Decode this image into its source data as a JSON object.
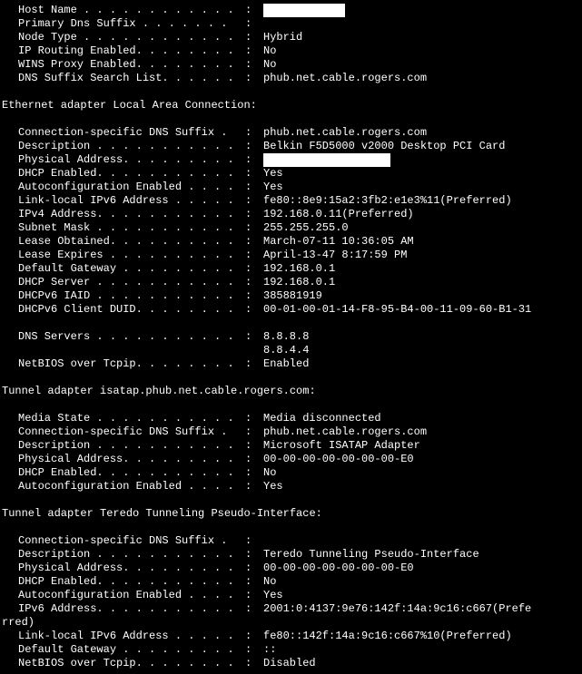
{
  "sep": ": ",
  "main": [
    {
      "label": "Host Name . . . . . . . . . . . .",
      "value": "",
      "block": 90
    },
    {
      "label": "Primary Dns Suffix  . . . . . . .",
      "value": ""
    },
    {
      "label": "Node Type . . . . . . . . . . . .",
      "value": "Hybrid"
    },
    {
      "label": "IP Routing Enabled. . . . . . . .",
      "value": "No"
    },
    {
      "label": "WINS Proxy Enabled. . . . . . . .",
      "value": "No"
    },
    {
      "label": "DNS Suffix Search List. . . . . .",
      "value": "phub.net.cable.rogers.com"
    }
  ],
  "ethHeader": "Ethernet adapter Local Area Connection:",
  "eth": [
    {
      "label": "Connection-specific DNS Suffix  .",
      "value": "phub.net.cable.rogers.com"
    },
    {
      "label": "Description . . . . . . . . . . .",
      "value": "Belkin F5D5000 v2000 Desktop PCI Card"
    },
    {
      "label": "Physical Address. . . . . . . . .",
      "value": "",
      "block": 140
    },
    {
      "label": "DHCP Enabled. . . . . . . . . . .",
      "value": "Yes"
    },
    {
      "label": "Autoconfiguration Enabled . . . .",
      "value": "Yes"
    },
    {
      "label": "Link-local IPv6 Address . . . . .",
      "value": "fe80::8e9:15a2:3fb2:e1e3%11(Preferred)"
    },
    {
      "label": "IPv4 Address. . . . . . . . . . .",
      "value": "192.168.0.11(Preferred)"
    },
    {
      "label": "Subnet Mask . . . . . . . . . . .",
      "value": "255.255.255.0"
    },
    {
      "label": "Lease Obtained. . . . . . . . . .",
      "value": "March-07-11 10:36:05 AM"
    },
    {
      "label": "Lease Expires . . . . . . . . . .",
      "value": "April-13-47 8:17:59 PM"
    },
    {
      "label": "Default Gateway . . . . . . . . .",
      "value": "192.168.0.1"
    },
    {
      "label": "DHCP Server . . . . . . . . . . .",
      "value": "192.168.0.1"
    },
    {
      "label": "DHCPv6 IAID . . . . . . . . . . .",
      "value": "385881919"
    },
    {
      "label": "DHCPv6 Client DUID. . . . . . . .",
      "value": "00-01-00-01-14-F8-95-B4-00-11-09-60-B1-31"
    }
  ],
  "eth2": [
    {
      "label": "DNS Servers . . . . . . . . . . .",
      "value": "8.8.8.8"
    },
    {
      "label": "",
      "value": "8.8.4.4",
      "nosep": true
    },
    {
      "label": "NetBIOS over Tcpip. . . . . . . .",
      "value": "Enabled"
    }
  ],
  "isatapHeader": "Tunnel adapter isatap.phub.net.cable.rogers.com:",
  "isatap": [
    {
      "label": "Media State . . . . . . . . . . .",
      "value": "Media disconnected"
    },
    {
      "label": "Connection-specific DNS Suffix  .",
      "value": "phub.net.cable.rogers.com"
    },
    {
      "label": "Description . . . . . . . . . . .",
      "value": "Microsoft ISATAP Adapter"
    },
    {
      "label": "Physical Address. . . . . . . . .",
      "value": "00-00-00-00-00-00-00-E0"
    },
    {
      "label": "DHCP Enabled. . . . . . . . . . .",
      "value": "No"
    },
    {
      "label": "Autoconfiguration Enabled . . . .",
      "value": "Yes"
    }
  ],
  "teredoHeader": "Tunnel adapter Teredo Tunneling Pseudo-Interface:",
  "teredo1": [
    {
      "label": "Connection-specific DNS Suffix  .",
      "value": ""
    },
    {
      "label": "Description . . . . . . . . . . .",
      "value": "Teredo Tunneling Pseudo-Interface"
    },
    {
      "label": "Physical Address. . . . . . . . .",
      "value": "00-00-00-00-00-00-00-E0"
    },
    {
      "label": "DHCP Enabled. . . . . . . . . . .",
      "value": "No"
    },
    {
      "label": "Autoconfiguration Enabled . . . .",
      "value": "Yes"
    },
    {
      "label": "IPv6 Address. . . . . . . . . . .",
      "value": "2001:0:4137:9e76:142f:14a:9c16:c667(Prefe"
    }
  ],
  "teredoWrap": "rred)",
  "teredo2": [
    {
      "label": "Link-local IPv6 Address . . . . .",
      "value": "fe80::142f:14a:9c16:c667%10(Preferred)"
    },
    {
      "label": "Default Gateway . . . . . . . . .",
      "value": "::"
    },
    {
      "label": "NetBIOS over Tcpip. . . . . . . .",
      "value": "Disabled"
    }
  ]
}
